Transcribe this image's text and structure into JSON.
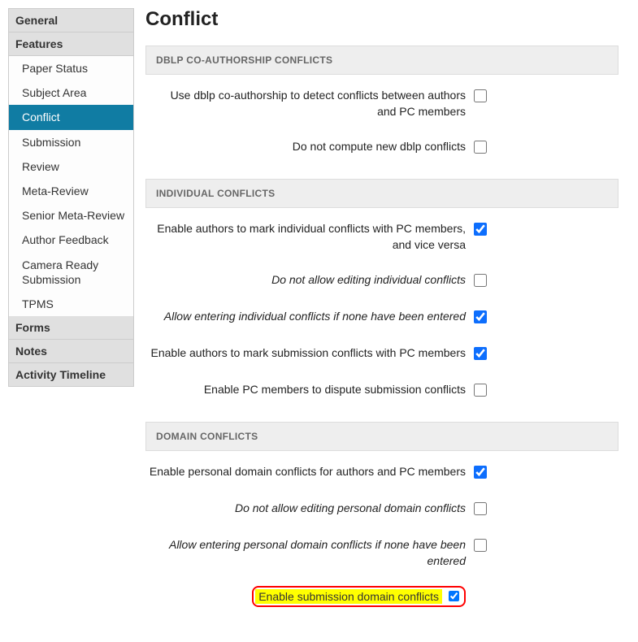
{
  "sidebar": {
    "general": "General",
    "features": "Features",
    "feature_items": [
      "Paper Status",
      "Subject Area",
      "Conflict",
      "Submission",
      "Review",
      "Meta-Review",
      "Senior Meta-Review",
      "Author Feedback",
      "Camera Ready Submission",
      "TPMS"
    ],
    "forms": "Forms",
    "notes": "Notes",
    "activity_timeline": "Activity Timeline",
    "active_index": 2
  },
  "main": {
    "title": "Conflict",
    "sections": [
      {
        "key": "dblp",
        "header": "DBLP CO-AUTHORSHIP CONFLICTS",
        "rows": [
          {
            "label": "Use dblp co-authorship to detect conflicts between authors and PC members",
            "checked": false,
            "italic": false
          },
          {
            "label": "Do not compute new dblp conflicts",
            "checked": false,
            "italic": false
          }
        ]
      },
      {
        "key": "individual",
        "header": "INDIVIDUAL CONFLICTS",
        "rows": [
          {
            "label": "Enable authors to mark individual conflicts with PC members, and vice versa",
            "checked": true,
            "italic": false
          },
          {
            "label": "Do not allow editing individual conflicts",
            "checked": false,
            "italic": true
          },
          {
            "label": "Allow entering individual conflicts if none have been entered",
            "checked": true,
            "italic": true
          },
          {
            "label": "Enable authors to mark submission conflicts with PC members",
            "checked": true,
            "italic": false
          },
          {
            "label": "Enable PC members to dispute submission conflicts",
            "checked": false,
            "italic": false
          }
        ]
      },
      {
        "key": "domain",
        "header": "DOMAIN CONFLICTS",
        "rows": [
          {
            "label": "Enable personal domain conflicts for authors and PC members",
            "checked": true,
            "italic": false
          },
          {
            "label": "Do not allow editing personal domain conflicts",
            "checked": false,
            "italic": true
          },
          {
            "label": "Allow entering personal domain conflicts if none have been entered",
            "checked": false,
            "italic": true
          },
          {
            "label": "Enable submission domain conflicts",
            "checked": true,
            "italic": false,
            "highlighted": true
          }
        ]
      }
    ]
  }
}
